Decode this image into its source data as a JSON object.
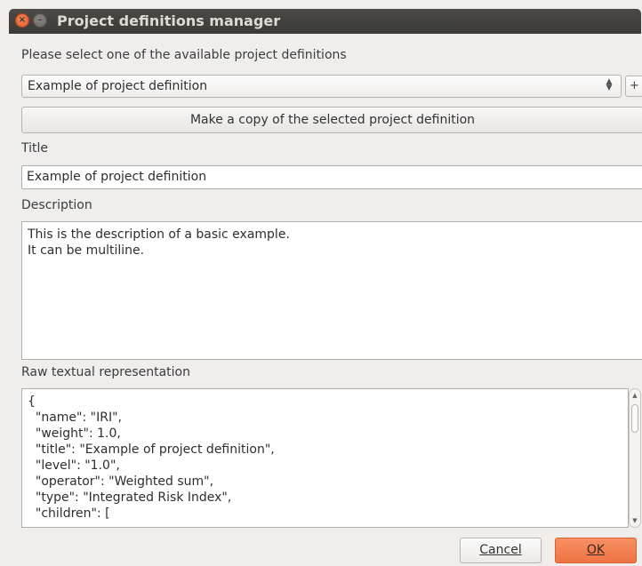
{
  "window": {
    "title": "Project definitions manager",
    "close_glyph": "×",
    "minimize_glyph": "–"
  },
  "select_label": "Please select one of the available project definitions",
  "project_select": {
    "value": "Example of project definition"
  },
  "add_button": {
    "label": "+"
  },
  "copy_button": {
    "label": "Make a copy of the selected project definition"
  },
  "title_field": {
    "label": "Title",
    "value": "Example of project definition"
  },
  "description_field": {
    "label": "Description",
    "value": "This is the description of a basic example.\nIt can be multiline."
  },
  "raw_field": {
    "label": "Raw textual representation",
    "lines": [
      "{",
      "  \"name\": \"IRI\",",
      "  \"weight\": 1.0,",
      "  \"title\": \"Example of project definition\",",
      "  \"level\": \"1.0\",",
      "  \"operator\": \"Weighted sum\",",
      "  \"type\": \"Integrated Risk Index\",",
      "  \"children\": ["
    ]
  },
  "buttons": {
    "cancel": "Cancel",
    "ok": "OK"
  },
  "colors": {
    "accent": "#ef7343",
    "titlebar": "#3b3a37",
    "close": "#e0552a"
  }
}
